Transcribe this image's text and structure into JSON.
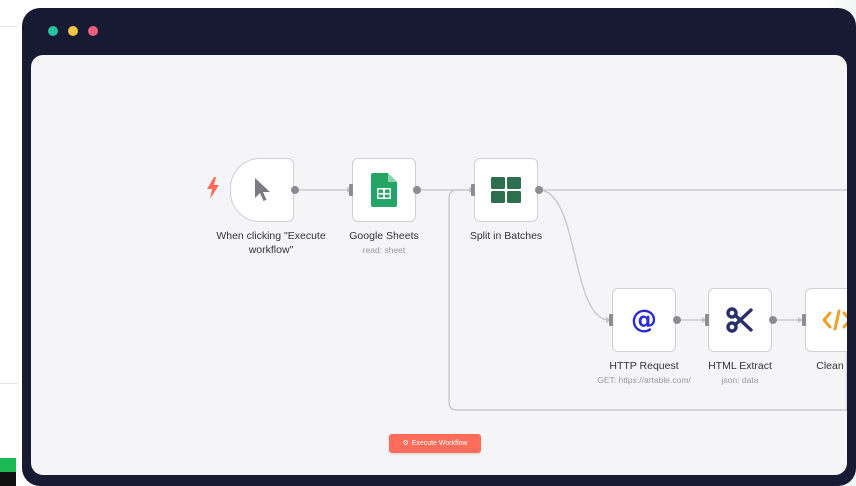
{
  "window": {
    "dots": [
      {
        "name": "green-dot",
        "color": "#27c1a0"
      },
      {
        "name": "yellow-dot",
        "color": "#f5c542"
      },
      {
        "name": "red-dot",
        "color": "#ef5f7d"
      }
    ]
  },
  "nodes": {
    "trigger": {
      "title": "When clicking \"Execute workflow\"",
      "icon": "cursor-arrow-icon"
    },
    "sheets": {
      "title": "Google Sheets",
      "subtitle": "read: sheet",
      "icon": "google-sheets-icon"
    },
    "split": {
      "title": "Split in Batches",
      "icon": "grid-icon"
    },
    "http": {
      "title": "HTTP Request",
      "subtitle": "GET: https://artable.com/",
      "icon": "at-sign-icon"
    },
    "extract": {
      "title": "HTML Extract",
      "subtitle": "json: data",
      "icon": "scissors-icon"
    },
    "clean": {
      "title": "Clean co",
      "icon": "code-icon"
    }
  },
  "toolbar": {
    "execute_label": "Execute Workflow",
    "execute_icon": "gear-icon"
  },
  "colors": {
    "window_frame": "#161a33",
    "canvas": "#f5f5f7",
    "accent": "#ff6d5a",
    "trigger_bolt": "#ff6d5a",
    "sheets_green": "#23a566",
    "split_green": "#2d6e4e",
    "http_blue": "#2b2bd6",
    "extract_navy": "#2a2f6b",
    "code_orange": "#f0a02a"
  }
}
